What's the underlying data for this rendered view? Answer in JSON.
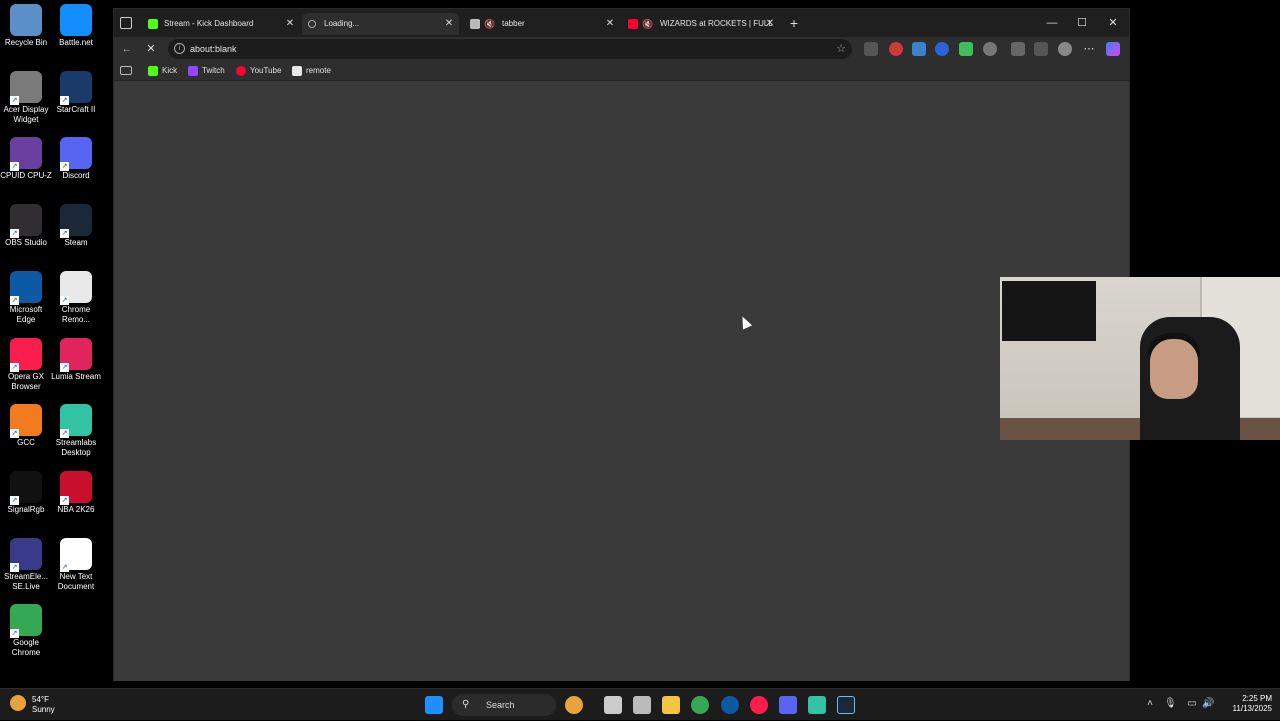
{
  "desktop": {
    "icons": [
      {
        "label": "Recycle Bin",
        "color": "#5b8fc7"
      },
      {
        "label": "Battle.net",
        "color": "#148eff"
      },
      {
        "label": "Acer Display Widget",
        "color": "#7a7a7a"
      },
      {
        "label": "StarCraft II",
        "color": "#1a3a6a"
      },
      {
        "label": "CPUID CPU-Z",
        "color": "#6b3fa0"
      },
      {
        "label": "Discord",
        "color": "#5865f2"
      },
      {
        "label": "OBS Studio",
        "color": "#302e31"
      },
      {
        "label": "Steam",
        "color": "#1b2838"
      },
      {
        "label": "Microsoft Edge",
        "color": "#0c59a4"
      },
      {
        "label": "Chrome Remo...",
        "color": "#e8e8e8"
      },
      {
        "label": "Opera GX Browser",
        "color": "#fa1e4e"
      },
      {
        "label": "Lumia Stream",
        "color": "#e0245e"
      },
      {
        "label": "GCC",
        "color": "#f47a20"
      },
      {
        "label": "Streamlabs Desktop",
        "color": "#31c3a2"
      },
      {
        "label": "SignalRgb",
        "color": "#111111"
      },
      {
        "label": "NBA 2K26",
        "color": "#c8102e"
      },
      {
        "label": "StreamEle... SE.Live",
        "color": "#3a3a8a"
      },
      {
        "label": "New Text Document",
        "color": "#ffffff"
      },
      {
        "label": "Google Chrome",
        "color": "#34a853"
      }
    ]
  },
  "browser": {
    "tabs": [
      {
        "title": "Stream - Kick Dashboard",
        "favicon_color": "#53fc18",
        "active": false
      },
      {
        "title": "Loading...",
        "favicon_color": "",
        "active": true
      },
      {
        "title": "tabber",
        "favicon_color": "#bbbbbb",
        "active": false
      },
      {
        "title": "WIZARDS at ROCKETS | FULL",
        "favicon_color": "#ff0033",
        "active": false
      }
    ],
    "new_tab_label": "+",
    "window_controls": {
      "minimize": "—",
      "maximize": "☐",
      "close": "✕"
    },
    "address": {
      "url": "about:blank"
    },
    "bookmarks": [
      {
        "label": "Kick",
        "color": "#53fc18"
      },
      {
        "label": "Twitch",
        "color": "#9146ff"
      },
      {
        "label": "YouTube",
        "color": "#ff0033"
      },
      {
        "label": "remote",
        "color": "#e8e8e8"
      }
    ],
    "icons": {
      "back": "arrow-left-icon",
      "reload": "stop-loading-icon",
      "star": "star-icon",
      "more": "more-dots-icon"
    }
  },
  "taskbar": {
    "weather": {
      "temp": "54°F",
      "condition": "Sunny"
    },
    "search_placeholder": "Search",
    "clock": {
      "time": "2:25 PM",
      "date": "11/13/2025"
    },
    "apps": [
      {
        "name": "start-icon",
        "color": "#1e90ff"
      },
      {
        "name": "widgets-icon",
        "color": "#e8a33c"
      },
      {
        "name": "task-view-icon",
        "color": "#cccccc"
      },
      {
        "name": "app-icon",
        "color": "#cccccc"
      },
      {
        "name": "file-explorer-icon",
        "color": "#f4c542"
      },
      {
        "name": "chrome-icon",
        "color": "#34a853"
      },
      {
        "name": "edge-icon",
        "color": "#0c59a4"
      },
      {
        "name": "opera-gx-icon",
        "color": "#fa1e4e"
      },
      {
        "name": "discord-icon",
        "color": "#5865f2"
      },
      {
        "name": "streamlabs-icon",
        "color": "#31c3a2"
      },
      {
        "name": "steam-icon",
        "color": "#1b2838"
      }
    ]
  }
}
